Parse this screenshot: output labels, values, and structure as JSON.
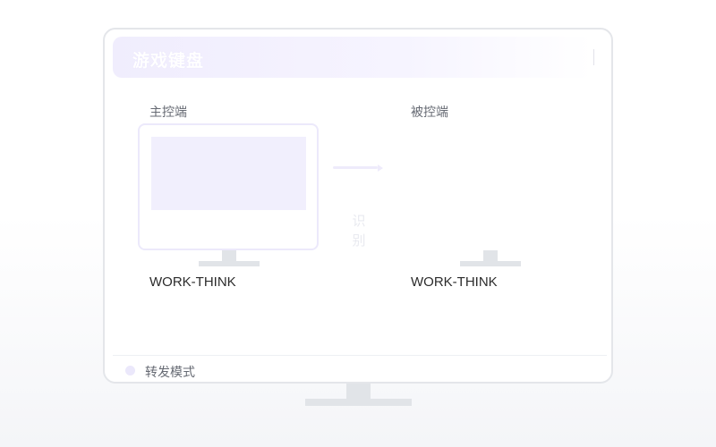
{
  "window": {
    "title": "游戏键盘"
  },
  "host": {
    "label": "主控端",
    "device_name": "WORK-THINK"
  },
  "client": {
    "label": "被控端",
    "device_name": "WORK-THINK"
  },
  "connection": {
    "status_text": "识别"
  },
  "footer": {
    "mode_label": "转发模式"
  },
  "colors": {
    "accent_light": "#f1effd",
    "border": "#e4e6ea",
    "stand": "#e1e4e8",
    "text_primary": "#2b2b2b",
    "text_secondary": "#666a73"
  }
}
